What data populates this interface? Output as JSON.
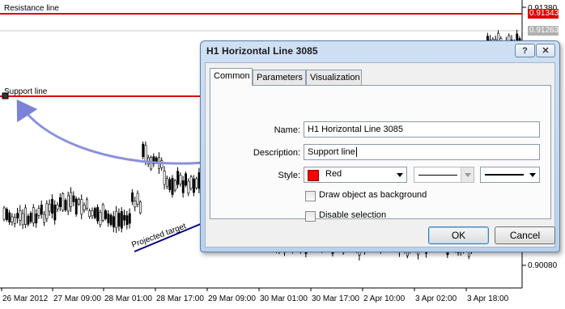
{
  "chart": {
    "resistance_label": "Resistance line",
    "support_label": "Support line",
    "projected_label": "Projected target",
    "line_color": "#dd0000",
    "price_labels": [
      "0.91380",
      "0.91343",
      "0.91263",
      "0.90080"
    ],
    "time_labels": [
      "26 Mar 2012",
      "27 Mar 09:00",
      "28 Mar 01:00",
      "28 Mar 17:00",
      "29 Mar 09:00",
      "30 Mar 01:00",
      "30 Mar 17:00",
      "2 Apr 10:00",
      "3 Apr 02:00",
      "3 Apr 18:00"
    ]
  },
  "dialog": {
    "title": "H1 Horizontal Line 3085",
    "help_label": "?",
    "close_label": "✕",
    "tabs": [
      "Common",
      "Parameters",
      "Visualization"
    ],
    "name_label": "Name:",
    "name_value": "H1 Horizontal Line 3085",
    "description_label": "Description:",
    "description_value": "Support line",
    "style_label": "Style:",
    "color_name": "Red",
    "color_swatch": "#ff0000",
    "background_checkbox": "Draw object as background",
    "selection_checkbox": "Disable selection",
    "ok_label": "OK",
    "cancel_label": "Cancel"
  }
}
